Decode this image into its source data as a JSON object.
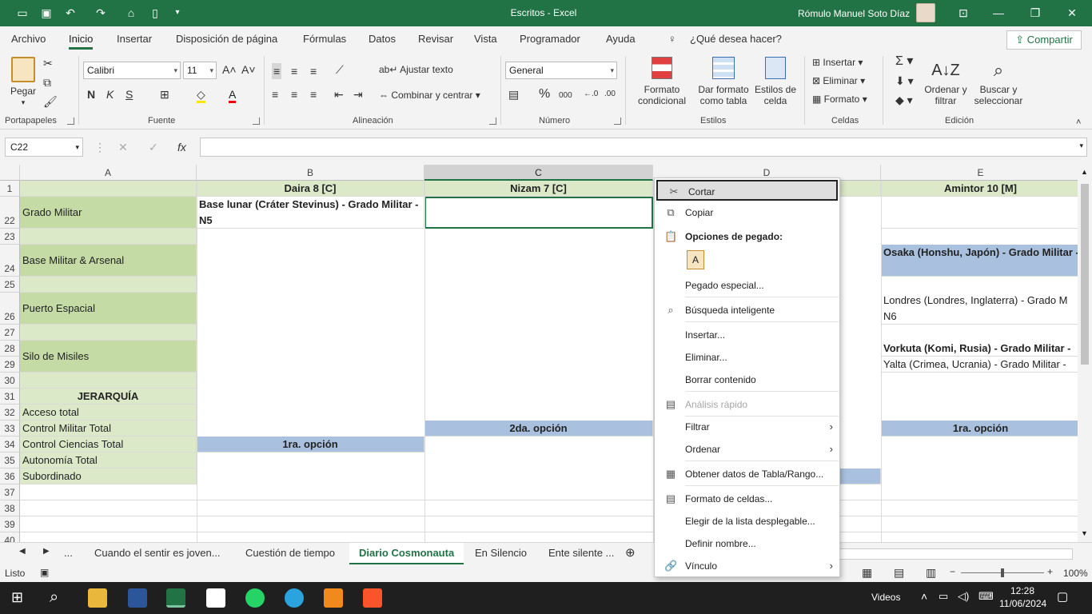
{
  "title_bar": {
    "title": "Escritos  -  Excel",
    "user": "Rómulo Manuel Soto Díaz"
  },
  "ribbon_tabs": [
    "Archivo",
    "Inicio",
    "Insertar",
    "Disposición de página",
    "Fórmulas",
    "Datos",
    "Revisar",
    "Vista",
    "Programador",
    "Ayuda"
  ],
  "tell_me": "¿Qué desea hacer?",
  "share": "Compartir",
  "clipboard": {
    "paste": "Pegar",
    "label": "Portapapeles"
  },
  "font": {
    "name": "Calibri",
    "size": "11",
    "bold": "N",
    "italic": "K",
    "underline": "S",
    "label": "Fuente"
  },
  "alignment": {
    "wrap": "Ajustar texto",
    "merge": "Combinar y centrar",
    "label": "Alineación"
  },
  "number": {
    "format": "General",
    "pct": "%",
    "thousands": "000",
    "label": "Número"
  },
  "styles": {
    "cond_format": "Formato condicional",
    "format_table": "Dar formato como tabla",
    "cell_styles": "Estilos de celda",
    "label": "Estilos"
  },
  "cells": {
    "insert": "Insertar",
    "delete": "Eliminar",
    "format": "Formato",
    "label": "Celdas"
  },
  "editing": {
    "sort": "Ordenar y filtrar",
    "find": "Buscar y seleccionar",
    "label": "Edición"
  },
  "name_box": "C22",
  "columns": [
    "A",
    "B",
    "C",
    "D",
    "E"
  ],
  "row1": {
    "B": "Daira 8 [C]",
    "C": "Nizam 7 [C]",
    "E": "Amintor 10 [M]"
  },
  "rows": {
    "r22": {
      "num": "22",
      "A": "Grado Militar",
      "B": "Base lunar (Cráter Stevinus) - Grado Militar - N5"
    },
    "r24": {
      "num": "24",
      "A": "Base Militar & Arsenal",
      "E": "Osaka (Honshu, Japón) - Grado Militar -"
    },
    "r26": {
      "num": "26",
      "A": "Puerto Espacial",
      "E": "Londres (Londres, Inglaterra) - Grado M N6"
    },
    "r28": {
      "num": "28",
      "A": "Silo de Misiles",
      "E": "Vorkuta (Komi, Rusia) - Grado Militar -"
    },
    "r29": {
      "num": "29",
      "E": "Yalta (Crimea, Ucrania) - Grado Militar -"
    },
    "r31": {
      "num": "31",
      "A": "JERARQUÍA"
    },
    "r32": {
      "num": "32",
      "A": "Acceso total"
    },
    "r33": {
      "num": "33",
      "A": "Control Militar Total",
      "C": "2da. opción",
      "E": "1ra. opción"
    },
    "r34": {
      "num": "34",
      "A": "Control Ciencias Total",
      "B": "1ra. opción"
    },
    "r35": {
      "num": "35",
      "A": "Autonomía Total"
    },
    "r36": {
      "num": "36",
      "A": "Subordinado"
    }
  },
  "row_numbers": [
    "1",
    "22",
    "23",
    "24",
    "25",
    "26",
    "27",
    "28",
    "29",
    "30",
    "31",
    "32",
    "33",
    "34",
    "35",
    "36",
    "37",
    "38",
    "39",
    "40"
  ],
  "sheet_tabs": [
    "...",
    "Cuando el sentir es joven...",
    "Cuestión de tiempo",
    "Diario Cosmonauta",
    "En Silencio",
    "Ente silente ..."
  ],
  "status": {
    "ready": "Listo",
    "zoom": "100%"
  },
  "context_menu": {
    "cut": "Cortar",
    "copy": "Copiar",
    "paste_options": "Opciones de pegado:",
    "paste_special": "Pegado especial...",
    "smart_lookup": "Búsqueda inteligente",
    "insert": "Insertar...",
    "delete": "Eliminar...",
    "clear": "Borrar contenido",
    "quick_analysis": "Análisis rápido",
    "filter": "Filtrar",
    "sort": "Ordenar",
    "get_data": "Obtener datos de Tabla/Rango...",
    "format_cells": "Formato de celdas...",
    "dropdown": "Elegir de la lista desplegable...",
    "define_name": "Definir nombre...",
    "link": "Vínculo"
  },
  "taskbar": {
    "videos": "Videos",
    "time": "12:28",
    "date": "11/06/2024"
  },
  "colors": {
    "accent": "#217346",
    "green_dark": "#c5dba6",
    "green_light": "#dbe9c9",
    "blue": "#a9c0de"
  }
}
